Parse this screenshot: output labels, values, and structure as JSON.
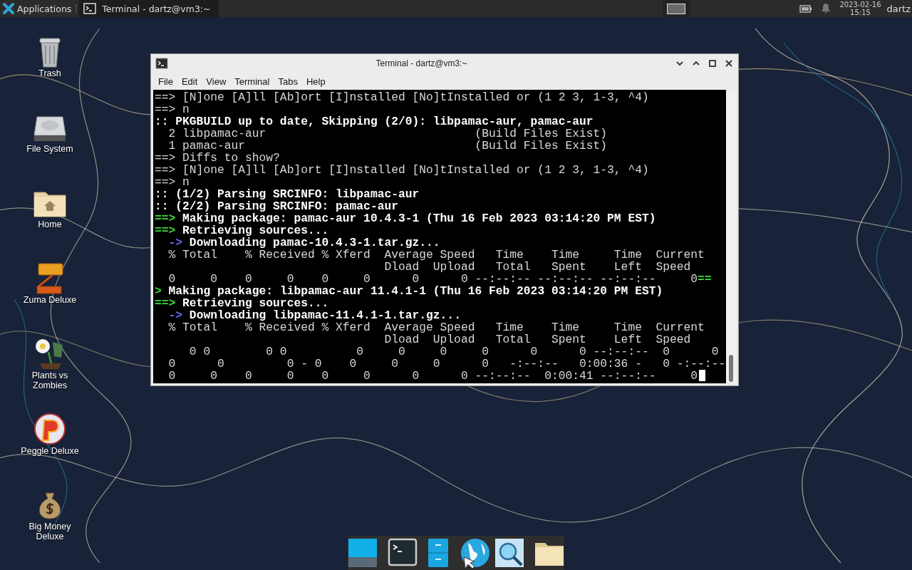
{
  "top_panel": {
    "applications_label": "Applications",
    "tasks": [
      {
        "title": "Terminal - dartz@vm3:~",
        "selected": true
      }
    ],
    "clock": {
      "date": "2023-02-16",
      "time": "15:15"
    },
    "user": "dartz"
  },
  "desktop_icons": [
    {
      "label": "Trash",
      "kind": "trash"
    },
    {
      "label": "File System",
      "kind": "drive"
    },
    {
      "label": "Home",
      "kind": "home"
    },
    {
      "label": "Zuma Deluxe",
      "kind": "blocks"
    },
    {
      "label": "Plants vs Zombies",
      "kind": "plant"
    },
    {
      "label": "Peggle Deluxe",
      "kind": "ball"
    },
    {
      "label": "Big Money Deluxe",
      "kind": "bag"
    }
  ],
  "window": {
    "title": "Terminal - dartz@vm3:~",
    "menu": [
      "File",
      "Edit",
      "View",
      "Terminal",
      "Tabs",
      "Help"
    ],
    "lines": [
      [
        {
          "text": "==> [N]one [A]ll [Ab]ort [I]nstalled [No]tInstalled or (1 2 3, 1-3, ^4)",
          "kind": "plain"
        }
      ],
      [
        {
          "text": "==> n",
          "kind": "plain"
        }
      ],
      [
        {
          "text": ":: PKGBUILD up to date, Skipping (2/0): libpamac-aur, pamac-aur",
          "kind": "bold"
        }
      ],
      [
        {
          "text": "  2 libpamac-aur                              (Build Files Exist)",
          "kind": "plain"
        }
      ],
      [
        {
          "text": "  1 pamac-aur                                 (Build Files Exist)",
          "kind": "plain"
        }
      ],
      [
        {
          "text": "==> Diffs to show?",
          "kind": "plain"
        }
      ],
      [
        {
          "text": "==> [N]one [A]ll [Ab]ort [I]nstalled [No]tInstalled or (1 2 3, 1-3, ^4)",
          "kind": "plain"
        }
      ],
      [
        {
          "text": "==> n",
          "kind": "plain"
        }
      ],
      [
        {
          "text": ":: (1/2) Parsing SRCINFO: libpamac-aur",
          "kind": "bold"
        }
      ],
      [
        {
          "text": ":: (2/2) Parsing SRCINFO: pamac-aur",
          "kind": "bold"
        }
      ],
      [
        {
          "text": "==>",
          "kind": "green"
        },
        {
          "text": " Making package: pamac-aur 10.4.3-1 (Thu 16 Feb 2023 03:14:20 PM EST)",
          "kind": "bold"
        }
      ],
      [
        {
          "text": "==>",
          "kind": "green"
        },
        {
          "text": " Retrieving sources...",
          "kind": "bold"
        }
      ],
      [
        {
          "text": "  ->",
          "kind": "blue"
        },
        {
          "text": " Downloading pamac-10.4.3-1.tar.gz...",
          "kind": "bold"
        }
      ],
      [
        {
          "text": "  % Total    % Received % Xferd  Average Speed   Time    Time     Time  Current",
          "kind": "plain"
        }
      ],
      [
        {
          "text": "                                 Dload  Upload   Total   Spent    Left  Speed",
          "kind": "plain"
        }
      ],
      [
        {
          "text": "  0     0    0     0    0     0      0      0 --:--:-- --:--:-- --:--:--     0",
          "kind": "plain"
        },
        {
          "text": "==",
          "kind": "green"
        }
      ],
      [
        {
          "text": ">",
          "kind": "green"
        },
        {
          "text": " Making package: libpamac-aur 11.4.1-1 (Thu 16 Feb 2023 03:14:20 PM EST)",
          "kind": "bold"
        }
      ],
      [
        {
          "text": "==>",
          "kind": "green"
        },
        {
          "text": " Retrieving sources...",
          "kind": "bold"
        }
      ],
      [
        {
          "text": "  ->",
          "kind": "blue"
        },
        {
          "text": " Downloading libpamac-11.4.1-1.tar.gz...",
          "kind": "bold"
        }
      ],
      [
        {
          "text": "  % Total    % Received % Xferd  Average Speed   Time    Time     Time  Current",
          "kind": "plain"
        }
      ],
      [
        {
          "text": "                                 Dload  Upload   Total   Spent    Left  Speed",
          "kind": "plain"
        }
      ],
      [
        {
          "text": "     0 0        0 0          0     0     0     0      0      0 --:--:--  0      0",
          "kind": "plain"
        }
      ],
      [
        {
          "text": "  0      0         0 - 0    0     0     0      0   -:--:--   0:00:36 -   0 -:--:--",
          "kind": "plain"
        }
      ],
      [
        {
          "text": "  0     0    0     0    0     0      0      0 --:--:--  0:00:41 --:--:--     0",
          "kind": "plain"
        }
      ]
    ]
  },
  "dock": {
    "items": [
      {
        "kind": "desktop"
      },
      {
        "kind": "separator"
      },
      {
        "kind": "terminal"
      },
      {
        "kind": "cabinet"
      },
      {
        "kind": "globe"
      },
      {
        "kind": "search"
      },
      {
        "kind": "separator"
      },
      {
        "kind": "folder"
      }
    ]
  }
}
